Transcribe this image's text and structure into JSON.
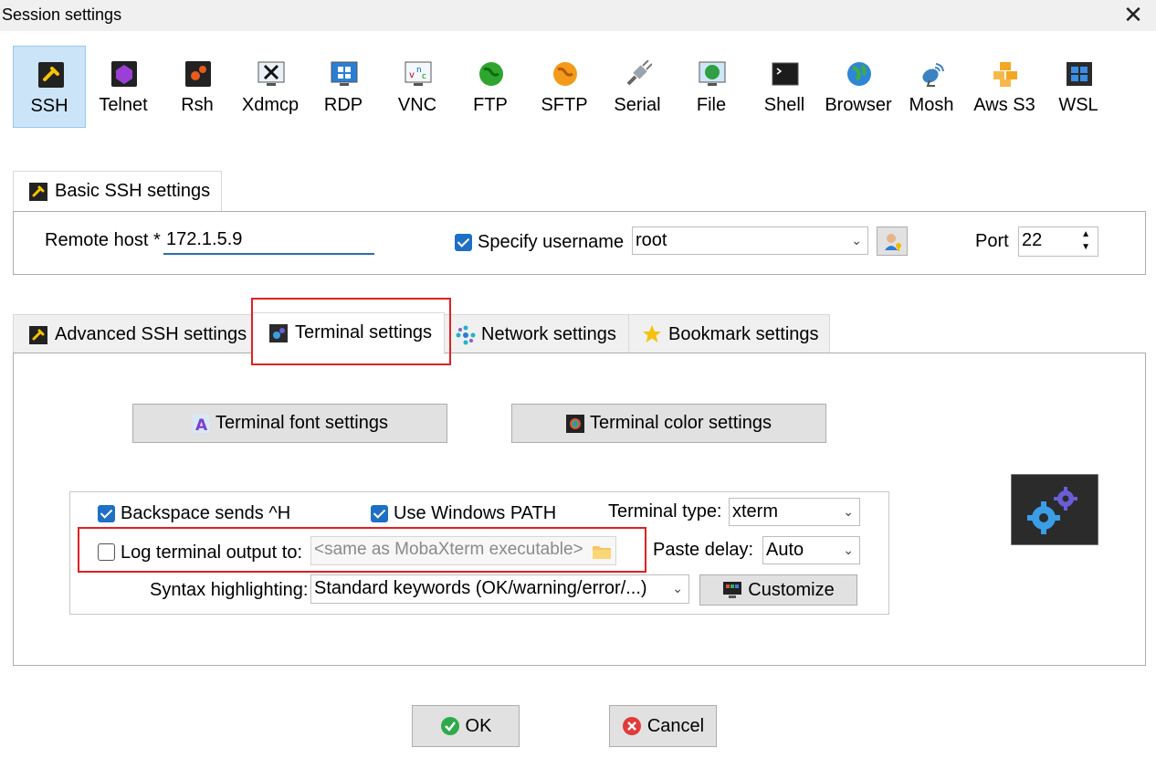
{
  "window": {
    "title": "Session settings",
    "close_glyph": "✕"
  },
  "protocols": [
    {
      "label": "SSH",
      "icon": "ssh-icon",
      "selected": true
    },
    {
      "label": "Telnet",
      "icon": "telnet-icon"
    },
    {
      "label": "Rsh",
      "icon": "rsh-icon"
    },
    {
      "label": "Xdmcp",
      "icon": "xdmcp-icon"
    },
    {
      "label": "RDP",
      "icon": "rdp-icon"
    },
    {
      "label": "VNC",
      "icon": "vnc-icon"
    },
    {
      "label": "FTP",
      "icon": "ftp-icon"
    },
    {
      "label": "SFTP",
      "icon": "sftp-icon"
    },
    {
      "label": "Serial",
      "icon": "serial-icon"
    },
    {
      "label": "File",
      "icon": "file-icon"
    },
    {
      "label": "Shell",
      "icon": "shell-icon"
    },
    {
      "label": "Browser",
      "icon": "browser-icon"
    },
    {
      "label": "Mosh",
      "icon": "mosh-icon"
    },
    {
      "label": "Aws S3",
      "icon": "aws-s3-icon"
    },
    {
      "label": "WSL",
      "icon": "wsl-icon"
    }
  ],
  "basic": {
    "tab_label": "Basic SSH settings",
    "remote_host_label": "Remote host *",
    "remote_host_value": "172.1.5.9",
    "specify_username_label": "Specify username",
    "specify_username_checked": true,
    "username_value": "root",
    "port_label": "Port",
    "port_value": "22"
  },
  "tabs": [
    {
      "label": "Advanced SSH settings",
      "icon": "wrench-icon"
    },
    {
      "label": "Terminal settings",
      "icon": "terminal-gears-icon",
      "active": true
    },
    {
      "label": "Network settings",
      "icon": "network-icon"
    },
    {
      "label": "Bookmark settings",
      "icon": "star-icon"
    }
  ],
  "terminal": {
    "font_button": "Terminal font settings",
    "color_button": "Terminal color settings",
    "backspace_label": "Backspace sends ^H",
    "backspace_checked": true,
    "windows_path_label": "Use Windows PATH",
    "windows_path_checked": true,
    "terminal_type_label": "Terminal type:",
    "terminal_type_value": "xterm",
    "log_output_label": "Log terminal output to:",
    "log_output_checked": false,
    "log_output_placeholder": "<same as MobaXterm executable>",
    "paste_delay_label": "Paste delay:",
    "paste_delay_value": "Auto",
    "syntax_label": "Syntax highlighting:",
    "syntax_value": "Standard keywords (OK/warning/error/...)",
    "customize_button": "Customize"
  },
  "footer": {
    "ok_label": "OK",
    "cancel_label": "Cancel"
  },
  "colors": {
    "accent": "#1f6fc5",
    "highlight_box": "#e02020",
    "selected_bg": "#cce4f7"
  }
}
